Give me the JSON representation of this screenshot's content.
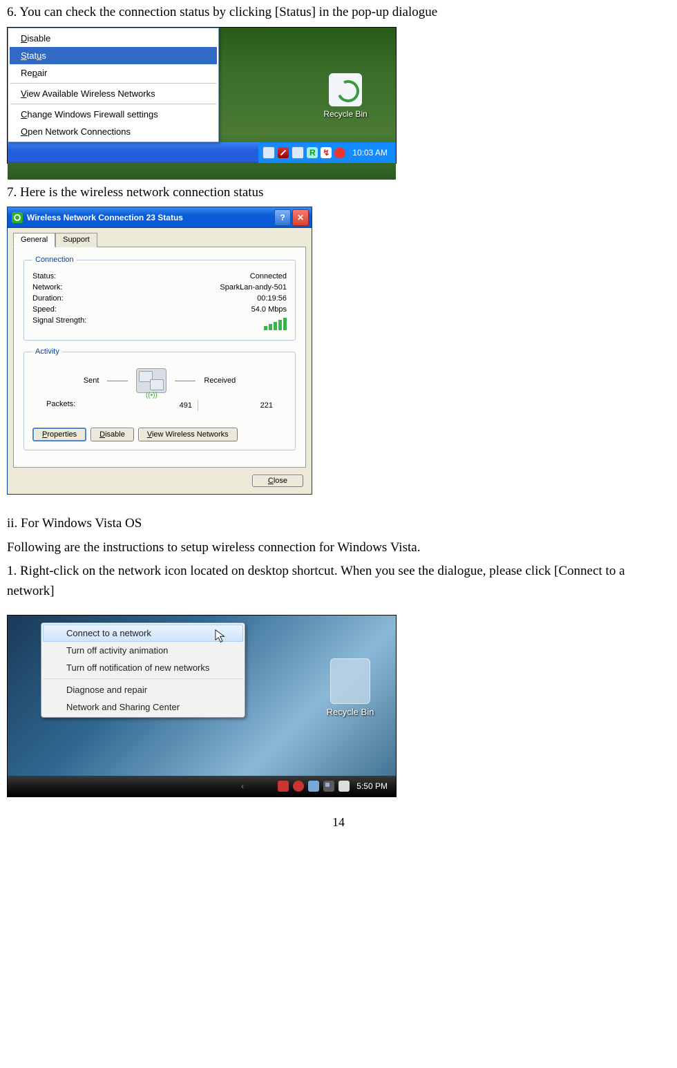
{
  "step6": "6. You can check the connection status by clicking [Status] in the pop-up dialogue",
  "step7": "7. Here is the wireless network connection status",
  "vista_heading": "ii. For Windows Vista OS",
  "vista_intro": "Following are the instructions to setup wireless connection for Windows Vista.",
  "vista_step1": "1. Right-click on the network icon located on desktop shortcut. When you see the dialogue, please click [Connect to a network]",
  "pagenum": "14",
  "xp_menu": {
    "items": [
      "Disable",
      "Status",
      "Repair",
      "View Available Wireless Networks",
      "Change Windows Firewall settings",
      "Open Network Connections"
    ],
    "selected": "Status"
  },
  "recycle_label": "Recycle Bin",
  "xp_clock": "10:03 AM",
  "xp_tray_r": "R",
  "status": {
    "title": "Wireless Network Connection 23 Status",
    "tabs": [
      "General",
      "Support"
    ],
    "group1": "Connection",
    "rows": {
      "status_l": "Status:",
      "status_v": "Connected",
      "network_l": "Network:",
      "network_v": "SparkLan-andy-501",
      "duration_l": "Duration:",
      "duration_v": "00:19:56",
      "speed_l": "Speed:",
      "speed_v": "54.0 Mbps",
      "signal_l": "Signal Strength:"
    },
    "group2": "Activity",
    "sent": "Sent",
    "received": "Received",
    "packets_l": "Packets:",
    "packets_sent": "491",
    "packets_recv": "221",
    "btn_props": "Properties",
    "btn_disable": "Disable",
    "btn_view": "View Wireless Networks",
    "btn_close": "Close"
  },
  "vista_menu": {
    "items": [
      "Connect to a network",
      "Turn off activity animation",
      "Turn off notification of new networks",
      "Diagnose and repair",
      "Network and Sharing Center"
    ],
    "selected": "Connect to a network"
  },
  "vista_recycle": "Recycle Bin",
  "vista_clock": "5:50 PM"
}
